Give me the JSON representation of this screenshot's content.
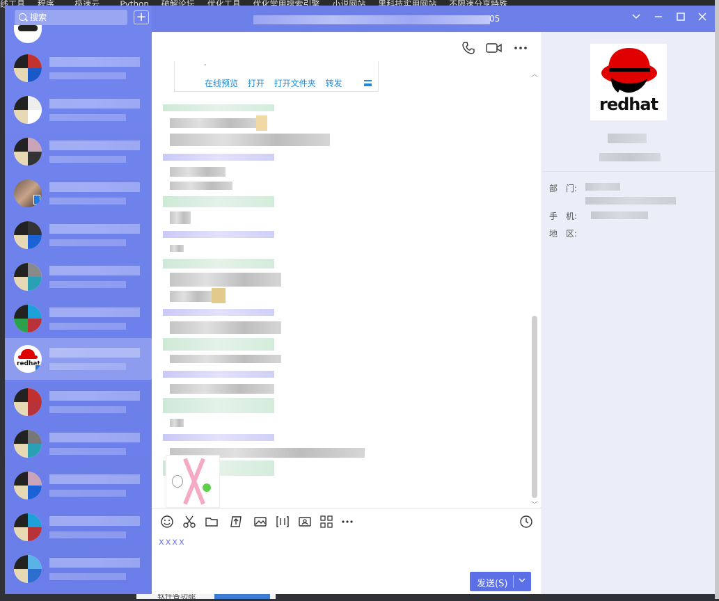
{
  "background": {
    "bookmarks": [
      "线工具",
      "程序...",
      "极速云...",
      "Python",
      "破解论坛",
      "优化工具",
      "优化常用搜索引擎",
      "小说网站",
      "黑科技实用网站",
      "不限速分享特殊..."
    ],
    "bottom_text": "软件各功能"
  },
  "sidebar": {
    "search_placeholder": "搜索",
    "add_label": "+"
  },
  "titlebar": {
    "title_suffix": "05"
  },
  "chat": {
    "file_actions": [
      "在线预览",
      "打开",
      "打开文件夹",
      "转发"
    ],
    "input_text": "xxxx",
    "send_label": "发送(S)"
  },
  "info": {
    "logo_text": "redhat",
    "fields": [
      {
        "label": "部　门:"
      },
      {
        "label": "手　机:"
      },
      {
        "label": "地　区:"
      }
    ]
  },
  "colors": {
    "sidebar": "#6d80ea",
    "accent_blue": "#1f88d8",
    "send_button": "#5b6fe6",
    "info_bg": "#ebeef8",
    "redhat_red": "#e00000"
  }
}
